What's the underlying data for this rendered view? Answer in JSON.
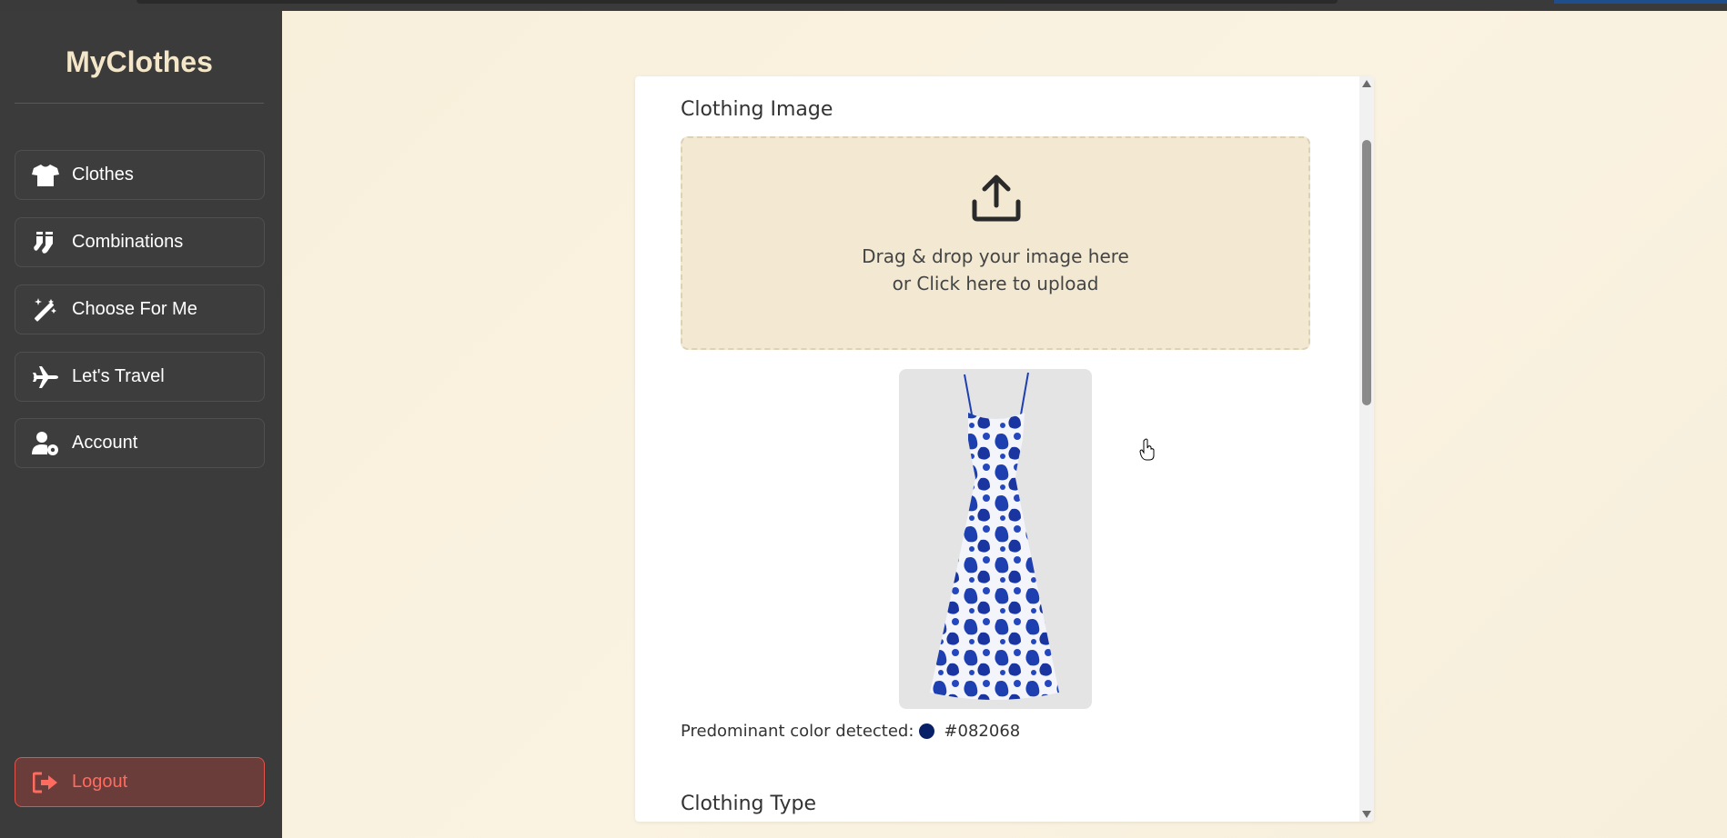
{
  "app": {
    "title": "MyClothes"
  },
  "sidebar": {
    "items": [
      {
        "label": "Clothes",
        "icon": "shirt-icon"
      },
      {
        "label": "Combinations",
        "icon": "socks-icon"
      },
      {
        "label": "Choose For Me",
        "icon": "magic-wand-icon"
      },
      {
        "label": "Let's Travel",
        "icon": "plane-icon"
      },
      {
        "label": "Account",
        "icon": "user-gear-icon"
      }
    ],
    "logout": {
      "label": "Logout",
      "icon": "logout-icon"
    }
  },
  "form": {
    "image_section": {
      "title": "Clothing Image"
    },
    "dropzone": {
      "line1": "Drag & drop your image here",
      "line2": "or Click here to upload",
      "icon": "upload-icon"
    },
    "preview": {
      "alt": "Blue floral maxi dress"
    },
    "color": {
      "label": "Predominant color detected:",
      "hex": "#082068"
    },
    "type_section": {
      "title": "Clothing Type"
    }
  },
  "colors": {
    "sidebar_bg": "#3b3b3b",
    "brand": "#f4e6c8",
    "logout_accent": "#ff6b5e",
    "dress_blue": "#1d3fb0"
  }
}
